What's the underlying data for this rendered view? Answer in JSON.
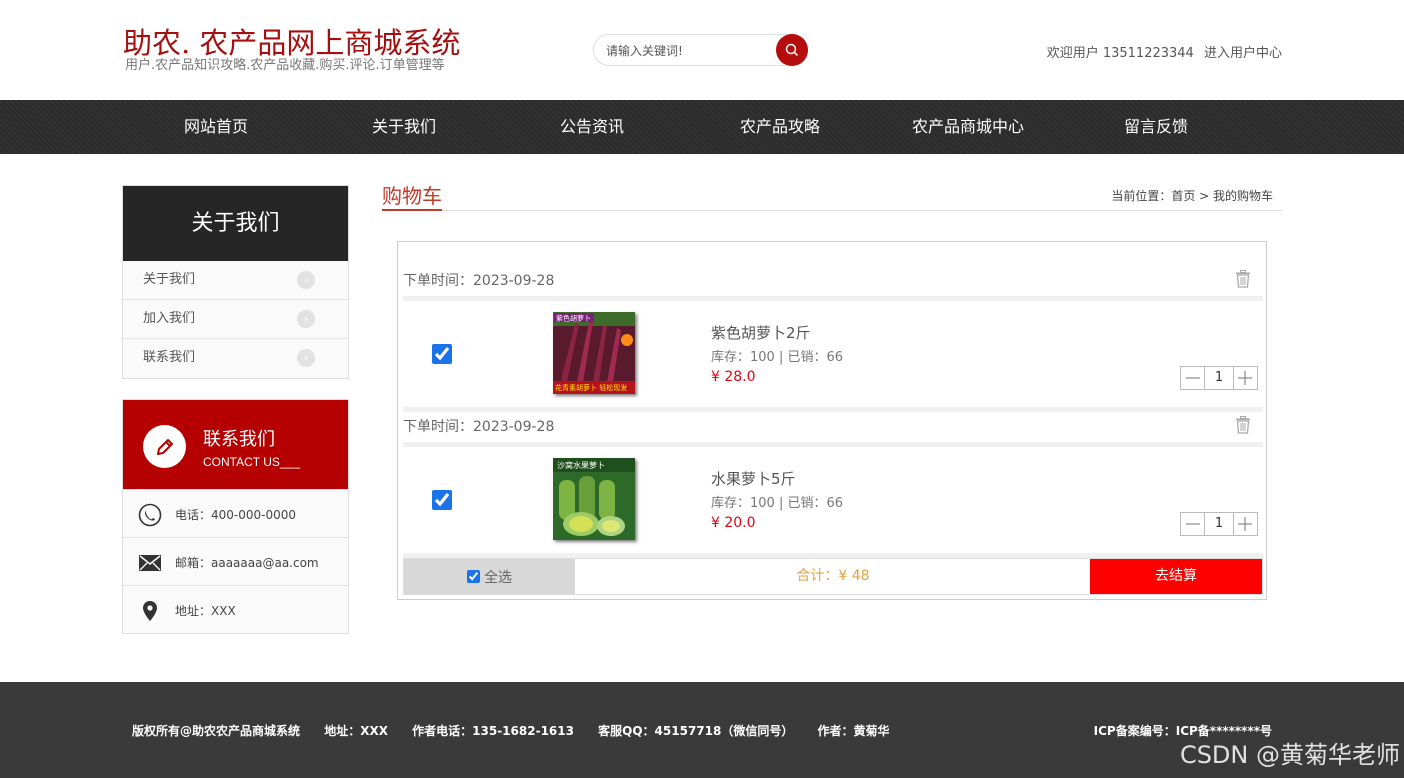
{
  "header": {
    "logo_title": "助农. 农产品网上商城系统",
    "logo_subtitle": "用户.农产品知识攻略.农产品收藏.购买.评论.订单管理等",
    "search_placeholder": "请输入关键词!",
    "welcome": "欢迎用户 13511223344",
    "user_center": "进入用户中心"
  },
  "nav": {
    "items": [
      "网站首页",
      "关于我们",
      "公告资讯",
      "农产品攻略",
      "农产品商城中心",
      "留言反馈"
    ]
  },
  "sidebar": {
    "about_title": "关于我们",
    "links": [
      "关于我们",
      "加入我们",
      "联系我们"
    ],
    "contact_title": "联系我们",
    "contact_en": "CONTACT US___",
    "phone": "电话：400-000-0000",
    "email": "邮箱：aaaaaaa@aa.com",
    "address": "地址：XXX"
  },
  "main": {
    "title": "购物车",
    "breadcrumb": "当前位置：首页 > 我的购物车"
  },
  "cart": {
    "orders": [
      {
        "time": "下单时间：2023-09-28",
        "name": "紫色胡萝卜2斤",
        "stock": "库存：100 | 已销：66",
        "price": "¥ 28.0",
        "qty": "1",
        "thumb_colors": [
          "#5a1a2e",
          "#8c2444",
          "#3d6b2a"
        ],
        "thumb_caption": "花青素胡萝卜 轻松现发",
        "thumb_banner": "紫色胡萝卜"
      },
      {
        "time": "下单时间：2023-09-28",
        "name": "水果萝卜5斤",
        "stock": "库存：100 | 已销：66",
        "price": "¥ 20.0",
        "qty": "1",
        "thumb_colors": [
          "#2d6a2a",
          "#9ccc65",
          "#d4e157"
        ],
        "thumb_caption": "",
        "thumb_banner": "沙窝水果萝卜"
      }
    ],
    "select_all": "全选",
    "total": "合计：¥ 48",
    "checkout": "去结算"
  },
  "footer": {
    "copyright": "版权所有@助农农产品商城系统",
    "address": "地址：XXX",
    "phone": "作者电话：135-1682-1613",
    "qq": "客服QQ：45157718（微信同号）",
    "author": "作者：黄菊华",
    "icp": "ICP备案编号：ICP备********号"
  },
  "watermark": "CSDN @黄菊华老师",
  "colors": {
    "brand_red": "#a40f10",
    "nav_bg": "#2b2b2b",
    "checkout_red": "#ff0000",
    "price_red": "#e60012",
    "total_orange": "#e6a23c"
  }
}
